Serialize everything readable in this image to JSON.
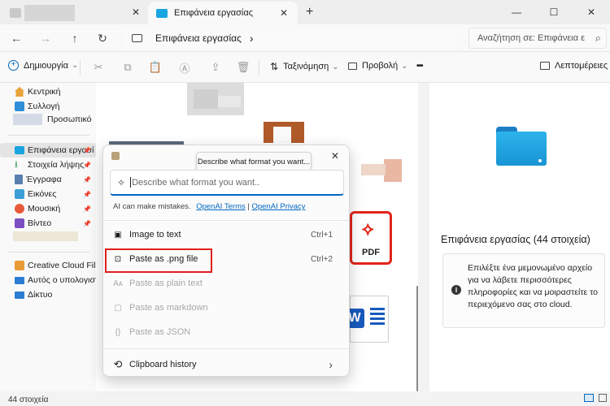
{
  "window": {
    "active_tab_title": "Επιφάνεια εργασίας",
    "tab_close_glyph": "✕",
    "new_tab_glyph": "+",
    "minimize_glyph": "—",
    "maximize_glyph": "☐",
    "close_glyph": "✕"
  },
  "nav": {
    "back_glyph": "←",
    "forward_glyph": "→",
    "up_glyph": "↑",
    "refresh_glyph": "↻",
    "address_text": "Επιφάνεια εργασίας",
    "address_chevron": "›",
    "search_placeholder": "Αναζήτηση σε: Επιφάνεια ε",
    "search_glyph": "⌕"
  },
  "toolbar": {
    "new_label": "Δημιουργία",
    "sort_label": "Ταξινόμηση",
    "view_label": "Προβολή",
    "more_glyph": "•••",
    "details_label": "Λεπτομέρειες",
    "dropdown_glyph": "⌄"
  },
  "sidebar": {
    "items": [
      {
        "label": "Κεντρική",
        "icon": "home-icon"
      },
      {
        "label": "Συλλογή",
        "icon": "gallery-icon"
      },
      {
        "label": "Προσωπικό",
        "icon": "onedrive-icon"
      },
      {
        "label": "Επιφάνεια εργασί",
        "icon": "desktop-icon"
      },
      {
        "label": "Στοιχεία λήψης",
        "icon": "download-icon"
      },
      {
        "label": "Έγγραφα",
        "icon": "documents-icon"
      },
      {
        "label": "Εικόνες",
        "icon": "pictures-icon"
      },
      {
        "label": "Μουσική",
        "icon": "music-icon"
      },
      {
        "label": "Βίντεο",
        "icon": "video-icon"
      },
      {
        "label": "Creative Cloud Files F",
        "icon": "creative-cloud-icon"
      },
      {
        "label": "Αυτός ο υπολογιστή",
        "icon": "this-pc-icon"
      },
      {
        "label": "Δίκτυο",
        "icon": "network-icon"
      }
    ],
    "pin_glyph": "📌"
  },
  "content": {
    "pdf_label": "PDF",
    "word_letter": "W"
  },
  "details": {
    "title": "Επιφάνεια εργασίας (44 στοιχεία)",
    "info_text": "Επιλέξτε ένα μεμονωμένο αρχείο για να λάβετε περισσότερες πληροφορίες και να μοιραστείτε το περιεχόμενο σας στο cloud.",
    "info_glyph": "i"
  },
  "status": {
    "item_count": "44 στοιχεία"
  },
  "popup": {
    "close_glyph": "✕",
    "tooltip": "Describe what format you want...",
    "input_placeholder": "Describe what format you want..",
    "disclaimer": "AI can make mistakes.",
    "link_terms": "OpenAI Terms",
    "link_sep": "|",
    "link_privacy": "OpenAI Privacy",
    "items": [
      {
        "label": "Image to text",
        "shortcut": "Ctrl+1",
        "glyph": "▣"
      },
      {
        "label": "Paste as .png file",
        "shortcut": "Ctrl+2",
        "glyph": "⊡"
      },
      {
        "label": "Paste as plain text",
        "shortcut": "",
        "glyph": "Aᴀ"
      },
      {
        "label": "Paste as markdown",
        "shortcut": "",
        "glyph": "▢"
      },
      {
        "label": "Paste as JSON",
        "shortcut": "",
        "glyph": "{}"
      }
    ],
    "history_label": "Clipboard history",
    "history_glyph": "⟲",
    "history_chevron": "›"
  },
  "colors": {
    "accent": "#0067c0",
    "highlight_box": "#e0201c",
    "pdf_red": "#e1251b",
    "word_blue": "#185abd"
  }
}
